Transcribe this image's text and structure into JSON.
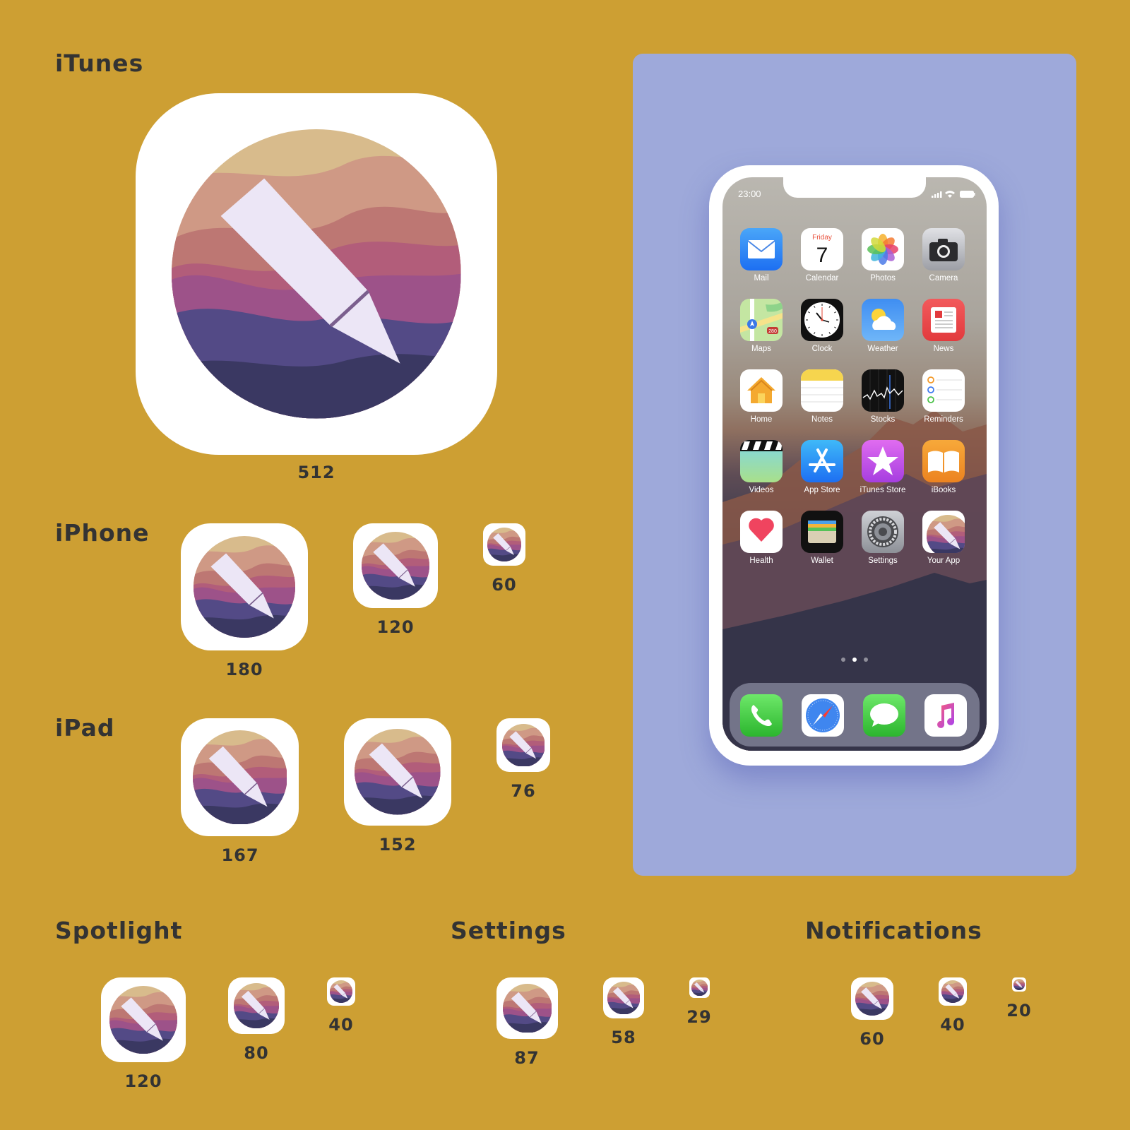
{
  "sections": {
    "itunes": {
      "title": "iTunes",
      "sizes": [
        "512"
      ]
    },
    "iphone": {
      "title": "iPhone",
      "sizes": [
        "180",
        "120",
        "60"
      ]
    },
    "ipad": {
      "title": "iPad",
      "sizes": [
        "167",
        "152",
        "76"
      ]
    },
    "spotlight": {
      "title": "Spotlight",
      "sizes": [
        "120",
        "80",
        "40"
      ]
    },
    "settings": {
      "title": "Settings",
      "sizes": [
        "87",
        "58",
        "29"
      ]
    },
    "notifications": {
      "title": "Notifications",
      "sizes": [
        "60",
        "40",
        "20"
      ]
    }
  },
  "colors": {
    "background": "#cd9f33",
    "panel": "#9ea9da",
    "icon_wave_1": "#d8bb8c",
    "icon_wave_2": "#cf9985",
    "icon_wave_3": "#bd7773",
    "icon_wave_4": "#b25d7a",
    "icon_wave_5": "#9d5289",
    "icon_wave_6": "#534a86",
    "icon_wave_7": "#3a3862",
    "pencil": "#ece6f6"
  },
  "phone": {
    "status_time": "23:00",
    "home_apps": [
      {
        "label": "Mail",
        "icon": "mail-icon"
      },
      {
        "label": "Calendar",
        "icon": "calendar-icon",
        "weekday": "Friday",
        "day": "7"
      },
      {
        "label": "Photos",
        "icon": "photos-icon"
      },
      {
        "label": "Camera",
        "icon": "camera-icon"
      },
      {
        "label": "Maps",
        "icon": "maps-icon",
        "badge": "280"
      },
      {
        "label": "Clock",
        "icon": "clock-icon"
      },
      {
        "label": "Weather",
        "icon": "weather-icon"
      },
      {
        "label": "News",
        "icon": "news-icon"
      },
      {
        "label": "Home",
        "icon": "home-icon"
      },
      {
        "label": "Notes",
        "icon": "notes-icon"
      },
      {
        "label": "Stocks",
        "icon": "stocks-icon"
      },
      {
        "label": "Reminders",
        "icon": "reminders-icon"
      },
      {
        "label": "Videos",
        "icon": "videos-icon"
      },
      {
        "label": "App Store",
        "icon": "app-store-icon"
      },
      {
        "label": "iTunes Store",
        "icon": "itunes-store-icon"
      },
      {
        "label": "iBooks",
        "icon": "ibooks-icon"
      },
      {
        "label": "Health",
        "icon": "health-icon"
      },
      {
        "label": "Wallet",
        "icon": "wallet-icon"
      },
      {
        "label": "Settings",
        "icon": "settings-icon"
      },
      {
        "label": "Your App",
        "icon": "your-app-icon"
      }
    ],
    "dock_apps": [
      {
        "icon": "phone-icon"
      },
      {
        "icon": "safari-icon"
      },
      {
        "icon": "messages-icon"
      },
      {
        "icon": "music-icon"
      }
    ],
    "page_count": 3,
    "current_page": 2
  }
}
